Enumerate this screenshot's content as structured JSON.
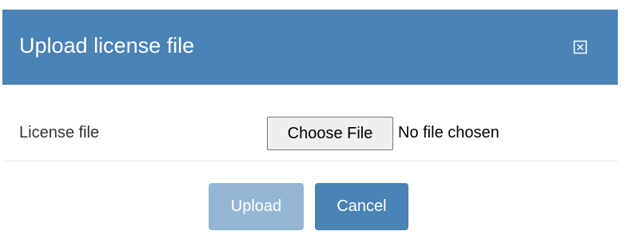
{
  "dialog": {
    "title": "Upload license file",
    "close_icon": "close-icon",
    "header_color": "#4a83b5"
  },
  "form": {
    "license_label": "License file",
    "file_button_label": "Choose File",
    "file_status": "No file chosen"
  },
  "footer": {
    "upload_label": "Upload",
    "upload_state": "disabled",
    "upload_color": "#94b6d5",
    "cancel_label": "Cancel",
    "cancel_color": "#4a83b5"
  }
}
